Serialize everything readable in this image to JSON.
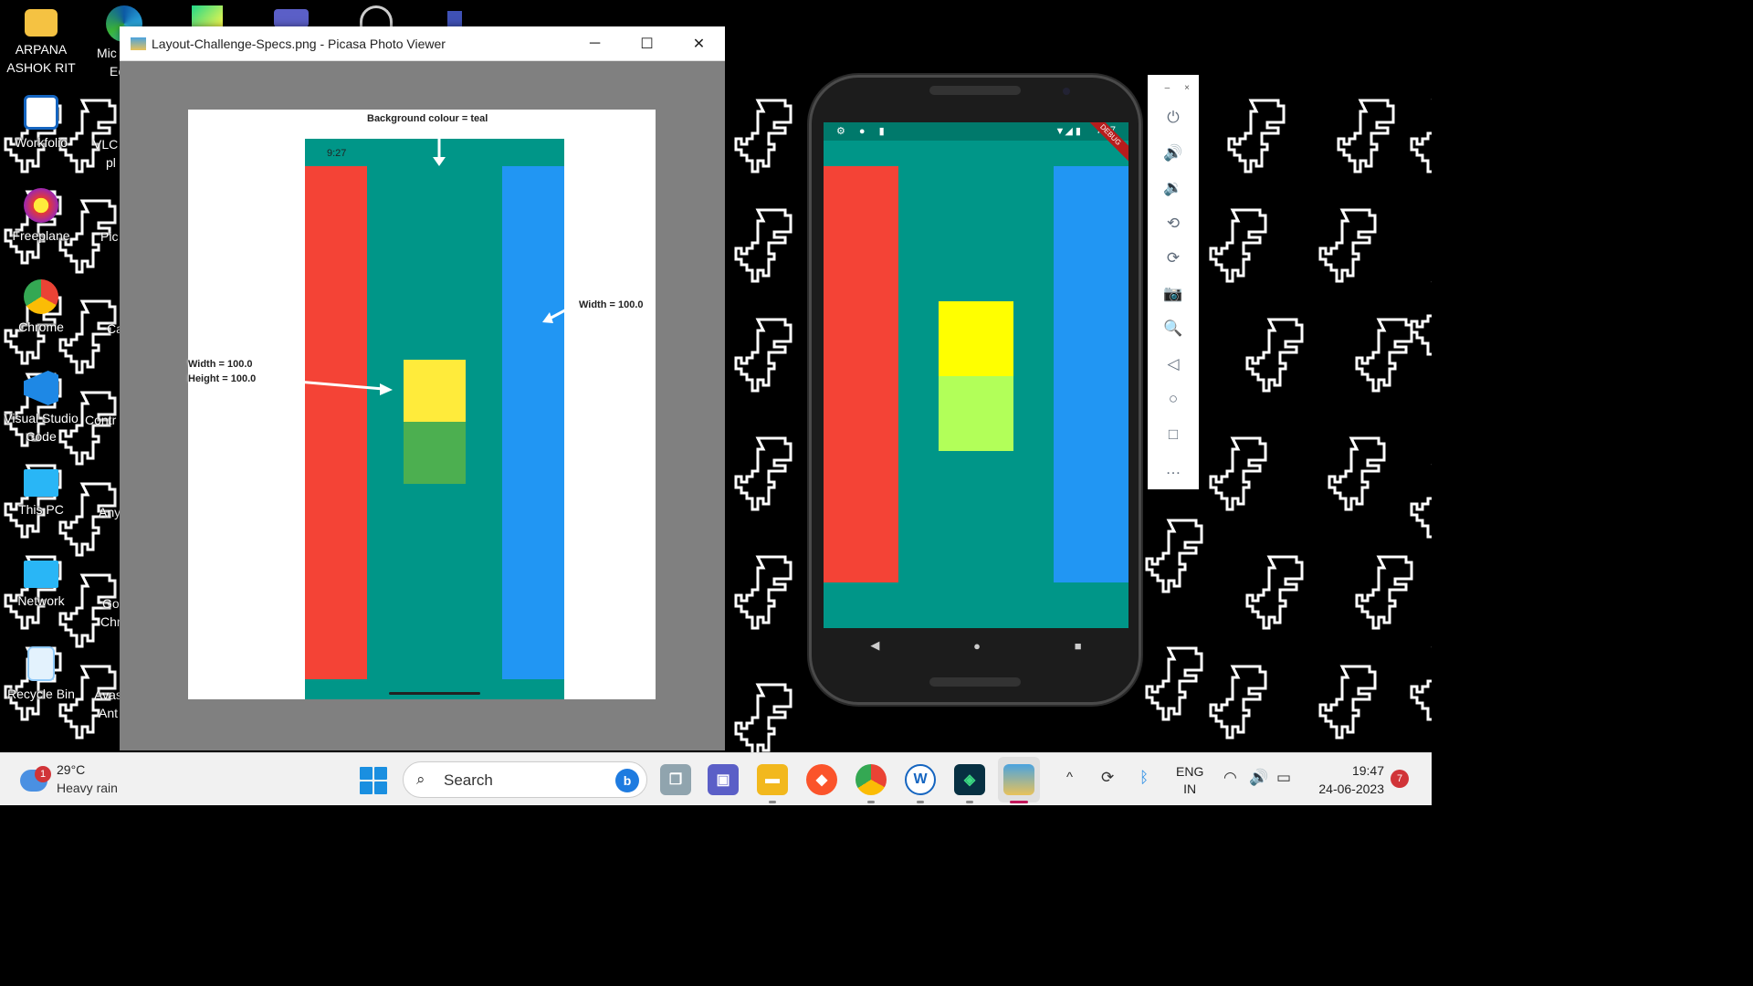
{
  "desktop": {
    "icons": [
      {
        "label": "ARPANA ASHOK RIT",
        "icon": "folder-icon",
        "color": "#f5c242"
      },
      {
        "label": "Workfolio",
        "icon": "workfolio-icon",
        "color": "#1565c0"
      },
      {
        "label": "Freeplane",
        "icon": "freeplane-icon",
        "color": "#e53935"
      },
      {
        "label": "Chrome",
        "icon": "chrome-icon",
        "color": "#4caf50"
      },
      {
        "label": "Visual Studio Code",
        "icon": "vscode-icon",
        "color": "#1e88e5"
      },
      {
        "label": "This PC",
        "icon": "monitor-icon",
        "color": "#29b6f6"
      },
      {
        "label": "Network",
        "icon": "network-icon",
        "color": "#29b6f6"
      },
      {
        "label": "Recycle Bin",
        "icon": "recycle-bin-icon",
        "color": "#90caf9"
      }
    ],
    "partial_icons": [
      "Mic",
      "Ec",
      "VLC",
      "pl",
      "Pic",
      "Ca",
      "Contr",
      "Any",
      "Go",
      "Chr",
      "Avas",
      "Ant"
    ]
  },
  "picasa": {
    "title": "Layout-Challenge-Specs.png - Picasa Photo Viewer",
    "minimize": "─",
    "maximize": "☐",
    "close": "✕",
    "spec": {
      "time": "9:27",
      "label_bg": "Background colour = teal",
      "label_width_right": "Width = 100.0",
      "label_width_left": "Width = 100.0",
      "label_height_left": "Height = 100.0"
    }
  },
  "phone": {
    "status_time": "7:47",
    "status_left_icons": "⚙ ● ▮",
    "status_right_icons": "▼◢ ▮",
    "debug": "DEBUG",
    "nav": {
      "back": "◀",
      "home": "●",
      "recents": "■"
    },
    "colors": {
      "background": "#009688",
      "left_bar": "#f44336",
      "right_bar": "#2196f3",
      "top_square": "#ffff00",
      "bottom_square": "#b2ff59"
    }
  },
  "emulator_toolbar": {
    "minimize": "–",
    "close": "×",
    "buttons": [
      {
        "name": "power-icon",
        "glyph": "⏻"
      },
      {
        "name": "volume-up-icon",
        "glyph": "🔊"
      },
      {
        "name": "volume-down-icon",
        "glyph": "🔉"
      },
      {
        "name": "rotate-left-icon",
        "glyph": "⟲"
      },
      {
        "name": "rotate-right-icon",
        "glyph": "⟳"
      },
      {
        "name": "camera-icon",
        "glyph": "📷"
      },
      {
        "name": "zoom-icon",
        "glyph": "🔍"
      },
      {
        "name": "back-icon",
        "glyph": "◁"
      },
      {
        "name": "home-icon",
        "glyph": "○"
      },
      {
        "name": "overview-icon",
        "glyph": "□"
      },
      {
        "name": "more-icon",
        "glyph": "…"
      }
    ]
  },
  "taskbar": {
    "weather": {
      "badge": "1",
      "temp": "29°C",
      "condition": "Heavy rain"
    },
    "search": {
      "label": "Search",
      "bing": "b"
    },
    "apps": [
      {
        "name": "task-view-icon",
        "glyph": "❐",
        "color": "#607d8b"
      },
      {
        "name": "teams-chat-icon",
        "glyph": "▣",
        "color": "#5b5fc7"
      },
      {
        "name": "file-explorer-icon",
        "glyph": "▬",
        "color": "#f2b81d"
      },
      {
        "name": "brave-icon",
        "glyph": "◆",
        "color": "#fb542b"
      },
      {
        "name": "chrome-taskbar-icon",
        "glyph": "◉",
        "color": "#34a853"
      },
      {
        "name": "workfolio-taskbar-icon",
        "glyph": "W",
        "color": "#1565c0"
      },
      {
        "name": "android-studio-icon",
        "glyph": "◈",
        "color": "#3ddc84"
      },
      {
        "name": "picasa-taskbar-icon",
        "glyph": "▦",
        "color": "#4aa3df"
      }
    ],
    "tray": {
      "chevron": "^",
      "language_line1": "ENG",
      "language_line2": "IN",
      "time": "19:47",
      "date": "24-06-2023",
      "notifications": "7"
    }
  }
}
